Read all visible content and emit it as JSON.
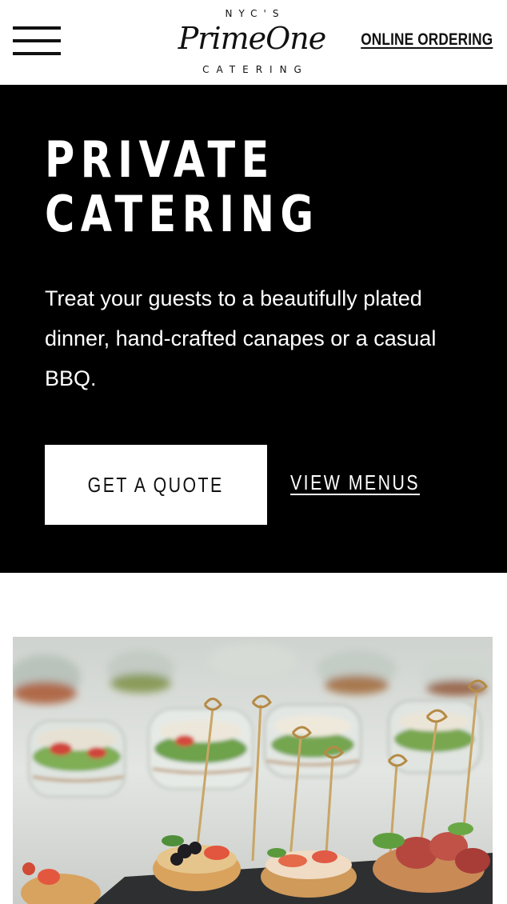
{
  "header": {
    "menu_icon": "hamburger-menu-icon",
    "logo": {
      "top_text": "NYC'S",
      "script_text": "PrimeOne",
      "bottom_text": "CATERING"
    },
    "online_ordering_label": "ONLINE ORDERING"
  },
  "hero": {
    "title_line1": "PRIVATE",
    "title_line2": "CATERING",
    "description": "Treat your guests to a beautifully plated dinner, hand-crafted canapes or a casual BBQ.",
    "quote_button_label": "GET A QUOTE",
    "view_menus_label": "VIEW MENUS"
  },
  "colors": {
    "hero_background": "#000000",
    "page_background": "#ffffff",
    "text_dark": "#111111"
  }
}
